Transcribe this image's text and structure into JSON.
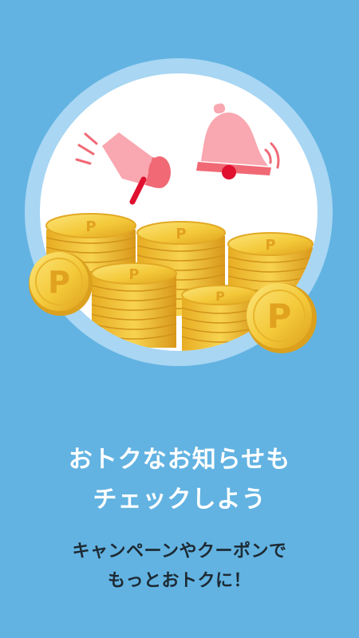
{
  "onboarding": {
    "headline_line1": "おトクなお知らせも",
    "headline_line2": "チェックしよう",
    "subline_line1": "キャンペーンやクーポンで",
    "subline_line2": "もっとおトクに！"
  },
  "illustration": {
    "icons": [
      "megaphone-icon",
      "bell-icon",
      "coin-stacks",
      "coin-icon"
    ],
    "coin_letter": "P"
  },
  "colors": {
    "background": "#62b3e2",
    "halo": "#a8d6f3",
    "circle": "#ffffff",
    "accent_pink": "#f5868f",
    "coin_gold": "#f4c732"
  }
}
